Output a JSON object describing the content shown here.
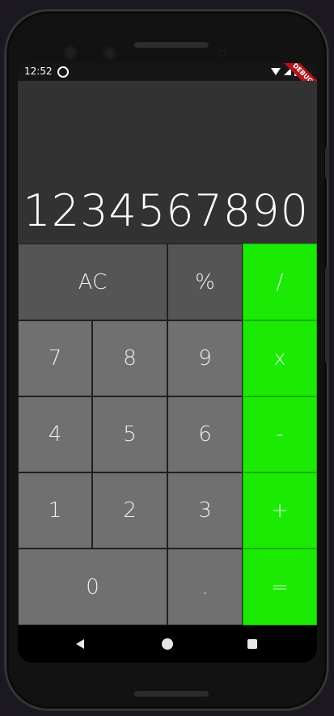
{
  "status_bar": {
    "time": "12:52",
    "debug_label": "DEBUG"
  },
  "display": {
    "value": "1234567890"
  },
  "keys": [
    {
      "id": "ac",
      "label": "AC"
    },
    {
      "id": "percent",
      "label": "%"
    },
    {
      "id": "divide",
      "label": "/"
    },
    {
      "id": "seven",
      "label": "7"
    },
    {
      "id": "eight",
      "label": "8"
    },
    {
      "id": "nine",
      "label": "9"
    },
    {
      "id": "multiply",
      "label": "x"
    },
    {
      "id": "four",
      "label": "4"
    },
    {
      "id": "five",
      "label": "5"
    },
    {
      "id": "six",
      "label": "6"
    },
    {
      "id": "minus",
      "label": "-"
    },
    {
      "id": "one",
      "label": "1"
    },
    {
      "id": "two",
      "label": "2"
    },
    {
      "id": "three",
      "label": "3"
    },
    {
      "id": "plus",
      "label": "+"
    },
    {
      "id": "zero",
      "label": "0"
    },
    {
      "id": "decimal",
      "label": "."
    },
    {
      "id": "equals",
      "label": "="
    }
  ],
  "colors": {
    "accent": "#1bea04",
    "display_bg": "#323232",
    "key_dark": "#555555",
    "key_mid": "#707070"
  },
  "nav_icons": [
    "back-icon",
    "home-icon",
    "recents-icon"
  ]
}
